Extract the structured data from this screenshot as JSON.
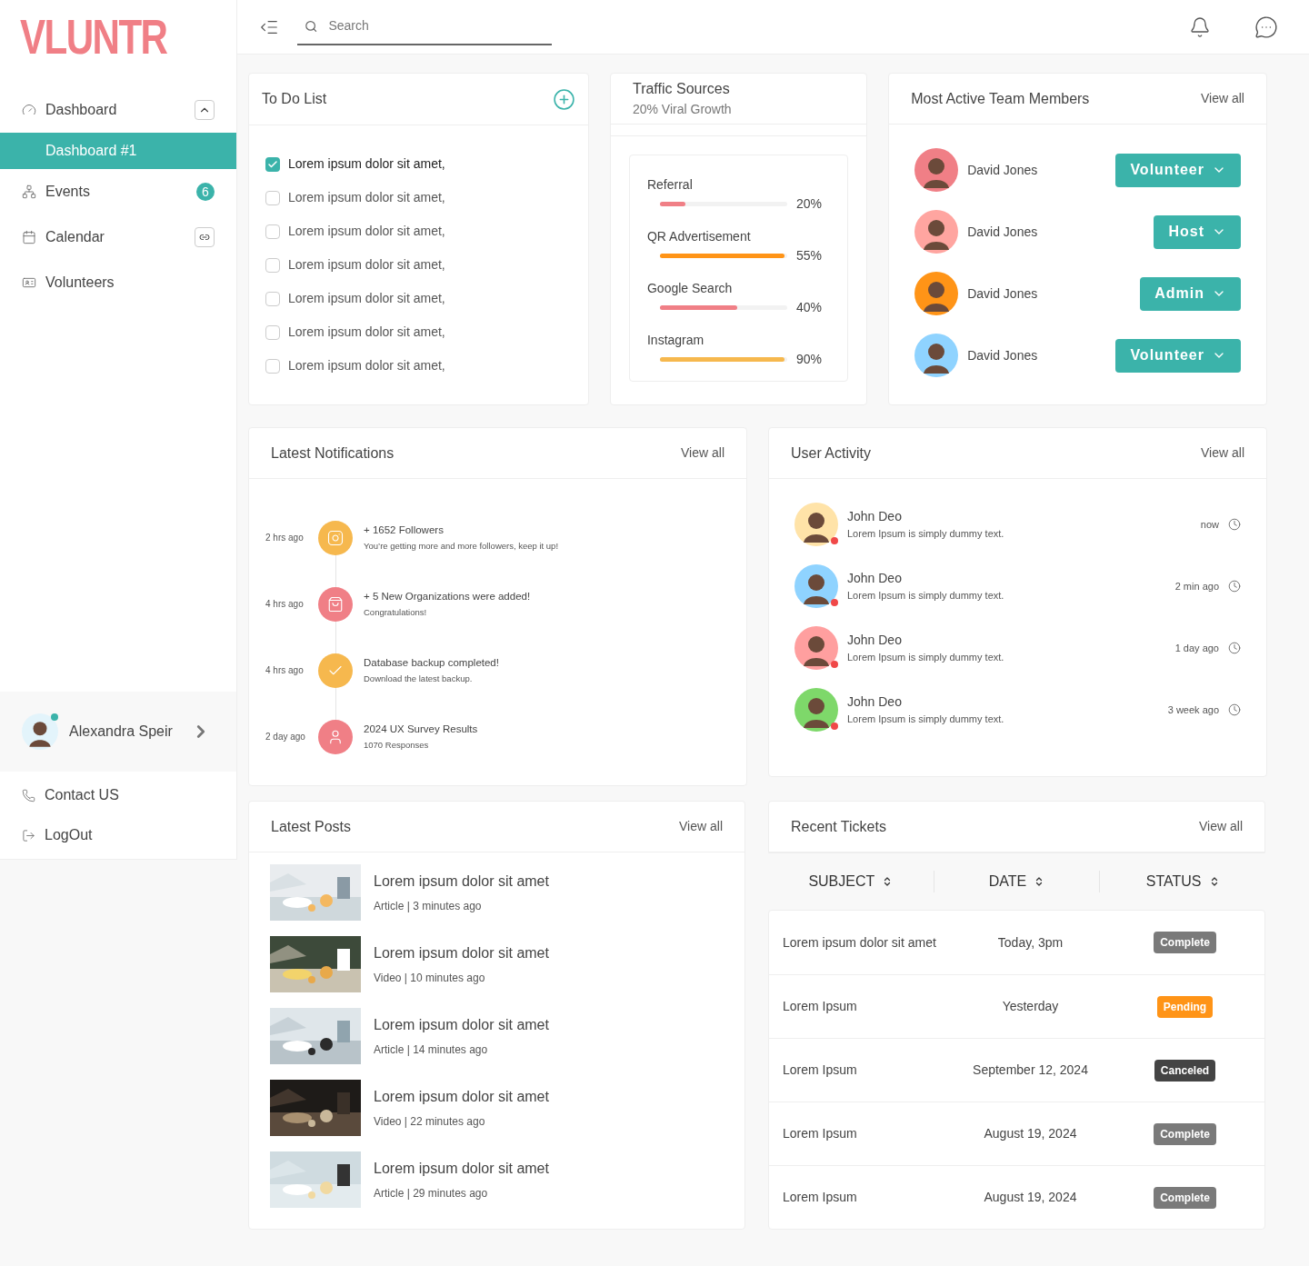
{
  "logo": "VLUNTR",
  "sidebar": {
    "items": [
      {
        "label": "Dashboard",
        "expanded": true,
        "children": [
          {
            "label": "Dashboard #1",
            "selected": true
          }
        ]
      },
      {
        "label": "Events",
        "badge": "6"
      },
      {
        "label": "Calendar"
      },
      {
        "label": "Volunteers"
      }
    ],
    "user": {
      "name": "Alexandra Speir",
      "online": true,
      "color": "#e3f4fb"
    },
    "footer": [
      {
        "label": "Contact US"
      },
      {
        "label": "LogOut"
      }
    ]
  },
  "search": {
    "placeholder": "Search"
  },
  "todo": {
    "title": "To Do List",
    "items": [
      {
        "label": "Lorem ipsum dolor sit amet,",
        "checked": true
      },
      {
        "label": "Lorem ipsum dolor sit amet,",
        "checked": false
      },
      {
        "label": "Lorem ipsum dolor sit amet,",
        "checked": false
      },
      {
        "label": "Lorem ipsum dolor sit amet,",
        "checked": false
      },
      {
        "label": "Lorem ipsum dolor sit amet,",
        "checked": false
      },
      {
        "label": "Lorem ipsum dolor sit amet,",
        "checked": false
      },
      {
        "label": "Lorem ipsum dolor sit amet,",
        "checked": false
      }
    ]
  },
  "traffic": {
    "title": "Traffic Sources",
    "subtitle": "20% Viral Growth",
    "sources": [
      {
        "name": "Referral",
        "level": 0.2,
        "reading": "20%",
        "color": "#f07f86"
      },
      {
        "name": "QR Advertisement",
        "level": 0.98,
        "reading": "55%",
        "color": "#ff9417"
      },
      {
        "name": "Google Search",
        "level": 0.61,
        "reading": "40%",
        "color": "#f07f86"
      },
      {
        "name": "Instagram",
        "level": 0.98,
        "reading": "90%",
        "color": "#f6b84e"
      }
    ]
  },
  "team": {
    "title": "Most Active Team Members",
    "link": "View all",
    "members": [
      {
        "name": "David Jones",
        "role": "Volunteer",
        "color": "#f07f86"
      },
      {
        "name": "David Jones",
        "role": "Host",
        "color": "#ffa5a0"
      },
      {
        "name": "David Jones",
        "role": "Admin",
        "color": "#ff9417"
      },
      {
        "name": "David Jones",
        "role": "Volunteer",
        "color": "#8fd3ff"
      }
    ]
  },
  "notifications": {
    "title": "Latest Notifications",
    "link": "View all",
    "items": [
      {
        "time": "2 hrs ago",
        "kind": "instagram",
        "color": "#f6b84e",
        "title": "+ 1652 Followers",
        "text": "You’re getting more and more followers, keep it up!"
      },
      {
        "time": "4 hrs ago",
        "kind": "bag",
        "color": "#f07f86",
        "title": "+ 5 New Organizations were added!",
        "text": "Congratulations!"
      },
      {
        "time": "4 hrs ago",
        "kind": "check",
        "color": "#f6b84e",
        "title": "Database backup completed!",
        "text": "Download the latest backup."
      },
      {
        "time": "2 day ago",
        "kind": "user",
        "color": "#f07f86",
        "title": "2024 UX Survey Results",
        "text": "1070 Responses"
      }
    ]
  },
  "activity": {
    "title": "User Activity",
    "link": "View all",
    "items": [
      {
        "name": "John Deo",
        "text": "Lorem Ipsum is simply dummy text.",
        "time": "now",
        "color": "#ffe3a8",
        "online": true
      },
      {
        "name": "John Deo",
        "text": "Lorem Ipsum is simply dummy text.",
        "time": "2 min ago",
        "color": "#8fd3ff",
        "online": true
      },
      {
        "name": "John Deo",
        "text": "Lorem Ipsum is simply dummy text.",
        "time": "1 day ago",
        "color": "#ff9f9f",
        "online": true
      },
      {
        "name": "John Deo",
        "text": "Lorem Ipsum is simply dummy text.",
        "time": "3 week ago",
        "color": "#7ed86a",
        "online": true
      }
    ]
  },
  "posts": {
    "title": "Latest Posts",
    "link": "View all",
    "items": [
      {
        "title": "Lorem ipsum dolor sit amet",
        "meta": "Article | 3 minutes ago"
      },
      {
        "title": "Lorem ipsum dolor sit amet",
        "meta": "Video | 10 minutes ago"
      },
      {
        "title": "Lorem ipsum dolor sit amet",
        "meta": "Article | 14 minutes ago"
      },
      {
        "title": "Lorem ipsum dolor sit amet",
        "meta": "Video | 22 minutes ago"
      },
      {
        "title": "Lorem ipsum dolor sit amet",
        "meta": "Article | 29 minutes ago"
      }
    ]
  },
  "tickets": {
    "title": "Recent Tickets",
    "link": "View all",
    "columns": [
      "SUBJECT",
      "DATE",
      "STATUS"
    ],
    "rows": [
      {
        "subject": "Lorem ipsum dolor sit amet",
        "date": "Today, 3pm",
        "status": "Complete",
        "kind": "complete"
      },
      {
        "subject": "Lorem Ipsum",
        "date": "Yesterday",
        "status": "Pending",
        "kind": "pending"
      },
      {
        "subject": "Lorem Ipsum",
        "date": "September 12, 2024",
        "status": "Canceled",
        "kind": "canceled"
      },
      {
        "subject": "Lorem Ipsum",
        "date": "August 19, 2024",
        "status": "Complete",
        "kind": "complete"
      },
      {
        "subject": "Lorem Ipsum",
        "date": "August 19, 2024",
        "status": "Complete",
        "kind": "complete"
      }
    ]
  }
}
